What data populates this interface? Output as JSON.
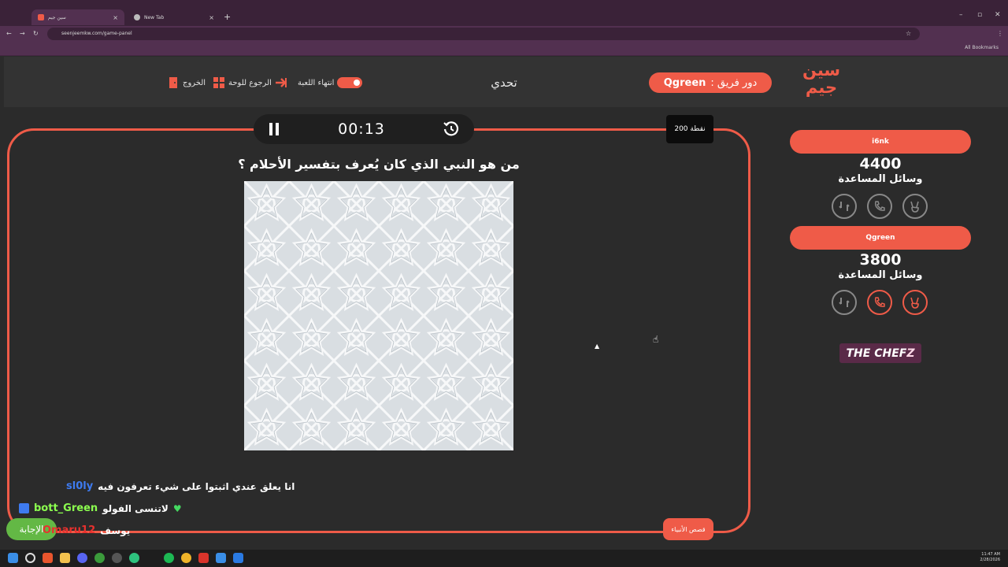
{
  "browser": {
    "tab_active_title": "سين جيم",
    "tab_inactive_title": "New Tab",
    "url": "seenjeemkw.com/game-panel",
    "bookmarks_label": "All Bookmarks"
  },
  "header": {
    "logo_text": "سين جيم",
    "team_turn_label": "دور فريق :",
    "team_turn_name": "Qgreen",
    "category": "تحدي",
    "end_game_label": "انتهاء اللعبة",
    "back_to_board_label": "الرجوع للوحة",
    "exit_label": "الخروج"
  },
  "question_panel": {
    "timer": "00:13",
    "points": "200 نقطة",
    "question": "من هو النبي الذي كان يُعرف بتفسير الأحلام ؟",
    "category_badge": "قصص الأنبياء",
    "answer_button": "الإجابة"
  },
  "chat": [
    {
      "user": "sl0ly",
      "message": "انا يعلق عندي اثبتوا على شيء تعرفون فيه",
      "user_color": "#3e7bf0"
    },
    {
      "user": "bott_Green",
      "message": "لاتنسى الفولو",
      "user_color": "#8cff4f"
    },
    {
      "user": "Omaru12",
      "message": "يوسف",
      "user_color": "#e8312e"
    }
  ],
  "teams": [
    {
      "name": "i6nk",
      "score": "4400",
      "aids_label": "وسائل المساعدة",
      "aids": [
        {
          "icon": "two-answers-icon",
          "active": false
        },
        {
          "icon": "phone-icon",
          "active": false
        },
        {
          "icon": "peace-hand-icon",
          "active": false
        }
      ]
    },
    {
      "name": "Qgreen",
      "score": "3800",
      "aids_label": "وسائل المساعدة",
      "aids": [
        {
          "icon": "two-answers-icon",
          "active": false
        },
        {
          "icon": "phone-icon",
          "active": true
        },
        {
          "icon": "peace-hand-icon",
          "active": true
        }
      ]
    }
  ],
  "sponsor": {
    "part1": "THE CHEF",
    "part2": "Z"
  },
  "taskbar": {
    "time": "11:47 AM",
    "date": "2/28/2026"
  },
  "colors": {
    "accent": "#ef5b48",
    "background": "#2b2b2b",
    "header": "#333333",
    "inactive_aid": "#888888",
    "answer_green": "#63b845"
  }
}
